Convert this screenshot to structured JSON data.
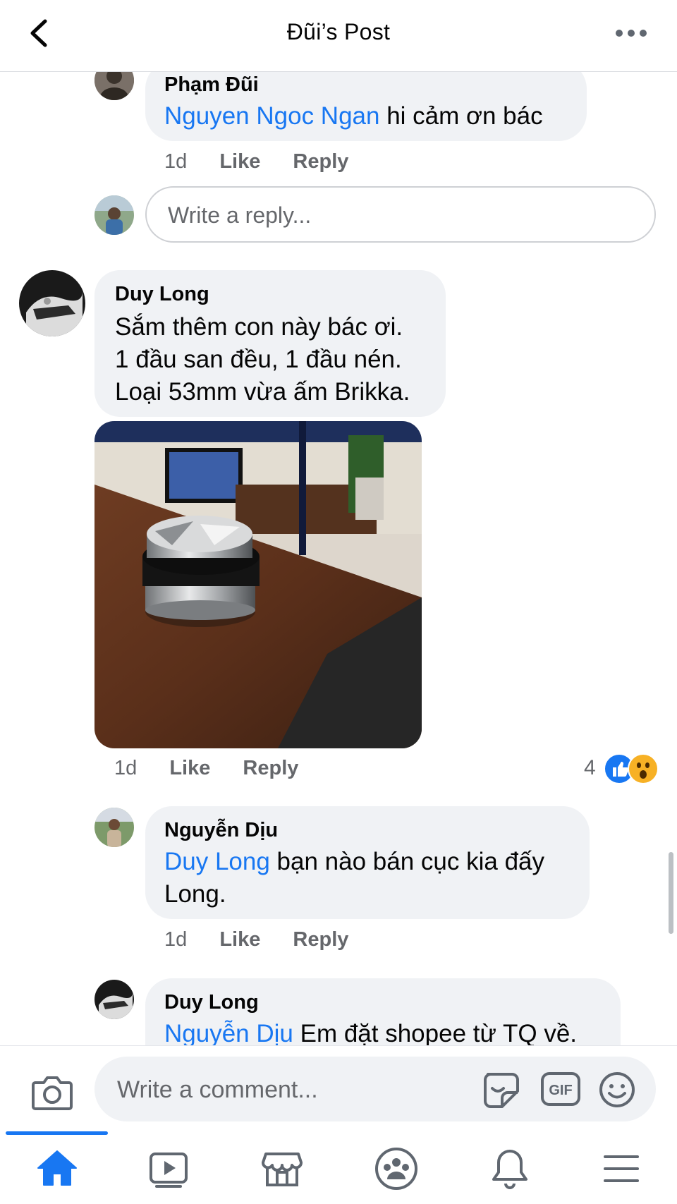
{
  "header": {
    "title": "Đũi’s Post"
  },
  "comments": [
    {
      "author": "Phạm Đũi",
      "mention": "Nguyen Ngoc Ngan",
      "text": " hi cảm ơn bác",
      "time": "1d",
      "like": "Like",
      "reply": "Reply"
    },
    {
      "author": "Duy Long",
      "lines": [
        "Sắm thêm con này bác ơi.",
        "1 đầu san đều, 1 đầu nén.",
        "Loại 53mm vừa ấm Brikka."
      ],
      "time": "1d",
      "like": "Like",
      "reply": "Reply",
      "reaction_count": "4",
      "reactions": [
        "like-reaction",
        "wow-reaction"
      ]
    },
    {
      "author": "Nguyễn Dịu",
      "mention": "Duy Long",
      "text": " bạn nào bán cục kia đấy",
      "text2": "Long.",
      "time": "1d",
      "like": "Like",
      "reply": "Reply"
    },
    {
      "author": "Duy Long",
      "mention": "Nguyễn Dịu",
      "text": " Em đặt shopee từ TQ về."
    }
  ],
  "reply_box": {
    "placeholder": "Write a reply..."
  },
  "composer": {
    "placeholder": "Write a comment...",
    "gif_label": "GIF"
  },
  "nav": {
    "items": [
      "home-icon",
      "watch-icon",
      "marketplace-icon",
      "groups-icon",
      "notifications-icon",
      "menu-icon"
    ],
    "active": "home-icon"
  },
  "colors": {
    "accent": "#1877f2",
    "bubble": "#f0f2f5",
    "secondary_text": "#65676b"
  }
}
